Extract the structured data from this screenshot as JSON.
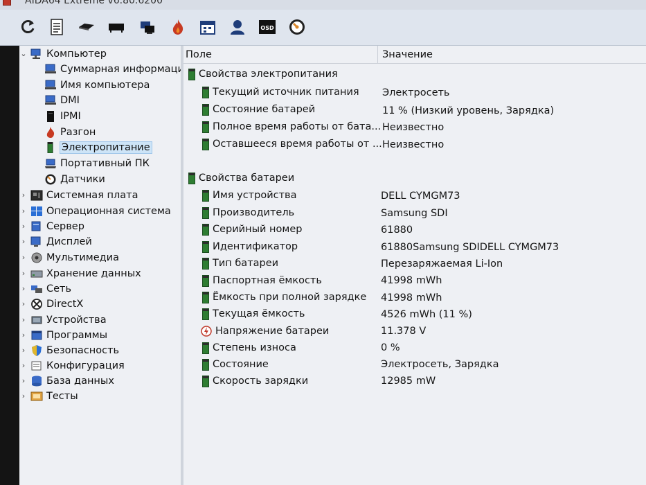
{
  "window": {
    "title": "AIDA64 Extreme v6.80.6200"
  },
  "toolbar": {
    "buttons": [
      {
        "name": "refresh-icon"
      },
      {
        "name": "report-icon"
      },
      {
        "name": "motherboard-icon"
      },
      {
        "name": "memory-icon"
      },
      {
        "name": "network-icon"
      },
      {
        "name": "flame-icon"
      },
      {
        "name": "calendar-icon"
      },
      {
        "name": "user-icon"
      },
      {
        "name": "osd-icon",
        "text": "OSD"
      },
      {
        "name": "gauge-icon"
      }
    ]
  },
  "tree": {
    "root": {
      "label": "Компьютер",
      "expanded": true
    },
    "children": [
      {
        "label": "Суммарная информаци",
        "icon": "computer-icon"
      },
      {
        "label": "Имя компьютера",
        "icon": "computer-icon"
      },
      {
        "label": "DMI",
        "icon": "computer-icon"
      },
      {
        "label": "IPMI",
        "icon": "server-icon"
      },
      {
        "label": "Разгон",
        "icon": "flame-icon"
      },
      {
        "label": "Электропитание",
        "icon": "battery-icon",
        "selected": true
      },
      {
        "label": "Портативный ПК",
        "icon": "laptop-icon"
      },
      {
        "label": "Датчики",
        "icon": "gauge-icon"
      }
    ],
    "categories": [
      {
        "label": "Системная плата",
        "icon": "motherboard-icon"
      },
      {
        "label": "Операционная система",
        "icon": "windows-icon"
      },
      {
        "label": "Сервер",
        "icon": "server-icon"
      },
      {
        "label": "Дисплей",
        "icon": "display-icon"
      },
      {
        "label": "Мультимедиа",
        "icon": "multimedia-icon"
      },
      {
        "label": "Хранение данных",
        "icon": "storage-icon"
      },
      {
        "label": "Сеть",
        "icon": "network-icon"
      },
      {
        "label": "DirectX",
        "icon": "xbox-icon"
      },
      {
        "label": "Устройства",
        "icon": "devices-icon"
      },
      {
        "label": "Программы",
        "icon": "programs-icon"
      },
      {
        "label": "Безопасность",
        "icon": "shield-icon"
      },
      {
        "label": "Конфигурация",
        "icon": "config-icon"
      },
      {
        "label": "База данных",
        "icon": "database-icon"
      },
      {
        "label": "Тесты",
        "icon": "tests-icon"
      }
    ]
  },
  "table": {
    "col_field": "Поле",
    "col_value": "Значение",
    "groups": [
      {
        "title": "Свойства электропитания",
        "rows": [
          {
            "field": "Текущий источник питания",
            "value": "Электросеть"
          },
          {
            "field": "Состояние батарей",
            "value": "11 % (Низкий уровень, Зарядка)"
          },
          {
            "field": "Полное время работы от бата...",
            "value": "Неизвестно"
          },
          {
            "field": "Оставшееся время работы от ...",
            "value": "Неизвестно"
          }
        ]
      },
      {
        "title": "Свойства батареи",
        "rows": [
          {
            "field": "Имя устройства",
            "value": "DELL CYMGM73"
          },
          {
            "field": "Производитель",
            "value": "Samsung SDI"
          },
          {
            "field": "Серийный номер",
            "value": "61880"
          },
          {
            "field": "Идентификатор",
            "value": "61880Samsung SDIDELL CYMGM73"
          },
          {
            "field": "Тип батареи",
            "value": "Перезаряжаемая Li-Ion"
          },
          {
            "field": "Паспортная ёмкость",
            "value": "41998 mWh"
          },
          {
            "field": "Ёмкость при полной зарядке",
            "value": "41998 mWh"
          },
          {
            "field": "Текущая ёмкость",
            "value": "4526 mWh  (11 %)"
          },
          {
            "field": "Напряжение батареи",
            "value": "11.378 V"
          },
          {
            "field": "Степень износа",
            "value": "0 %"
          },
          {
            "field": "Состояние",
            "value": "Электросеть, Зарядка"
          },
          {
            "field": "Скорость зарядки",
            "value": "12985 mW"
          }
        ]
      }
    ]
  },
  "colors": {
    "pane_bg": "#eef0f4",
    "toolbar_bg": "#dfe5ee",
    "selection_bg": "#cde4f7",
    "battery_green": "#2e7d32"
  }
}
